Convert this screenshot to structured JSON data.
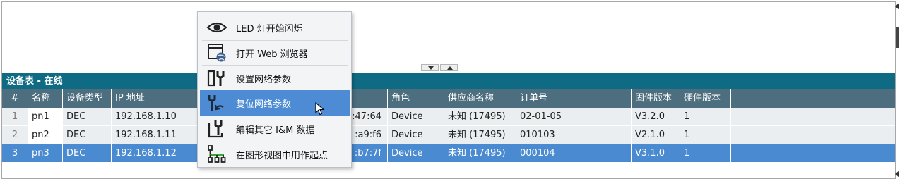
{
  "panel": {
    "title": "设备表 - 在线"
  },
  "table": {
    "headers": [
      "#",
      "名称",
      "设备类型",
      "IP 地址",
      "",
      "",
      "角色",
      "供应商名称",
      "订单号",
      "固件版本",
      "硬件版本"
    ],
    "rows": [
      {
        "idx": "1",
        "name": "pn1",
        "type": "DEC",
        "ip": "192.168.1.10",
        "mac": ":47:64",
        "role": "Device",
        "vendor": "未知 (17495)",
        "order": "02-01-05",
        "fw": "V3.2.0",
        "hw": "1",
        "selected": false
      },
      {
        "idx": "2",
        "name": "pn2",
        "type": "DEC",
        "ip": "192.168.1.11",
        "mac": ":a9:f6",
        "role": "Device",
        "vendor": "未知 (17495)",
        "order": "010103",
        "fw": "V2.1.0",
        "hw": "1",
        "selected": false
      },
      {
        "idx": "3",
        "name": "pn3",
        "type": "DEC",
        "ip": "192.168.1.12",
        "mac": ":b7:7f",
        "role": "Device",
        "vendor": "未知 (17495)",
        "order": "000104",
        "fw": "V3.1.0",
        "hw": "1",
        "selected": true
      }
    ]
  },
  "context_menu": {
    "items": [
      {
        "label": "LED 灯开始闪烁",
        "icon": "eye-icon"
      },
      {
        "label": "打开 Web 浏览器",
        "icon": "web-browser-icon"
      },
      {
        "label": "设置网络参数",
        "icon": "network-settings-icon"
      },
      {
        "label": "复位网络参数",
        "icon": "reset-network-icon",
        "highlighted": true
      },
      {
        "label": "编辑其它 I&M 数据",
        "icon": "edit-im-data-icon"
      },
      {
        "label": "在图形视图中用作起点",
        "icon": "graph-start-icon"
      }
    ]
  },
  "colors": {
    "panel_title_bg": "#0e6b83",
    "header_bg": "#4d6e7f",
    "selected_row_bg": "#4a8ad0",
    "menu_highlight_bg": "#4d8bd4"
  }
}
